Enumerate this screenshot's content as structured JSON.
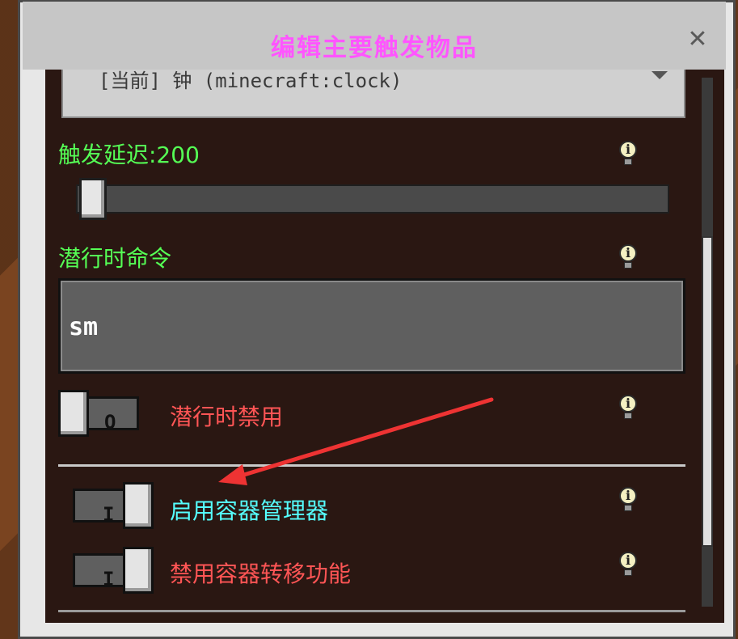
{
  "dialog": {
    "title": "编辑主要触发物品",
    "close_icon": "close-icon"
  },
  "dropdown": {
    "value": "[当前] 钟 (minecraft:clock)"
  },
  "trigger_delay": {
    "label": "触发延迟:200",
    "slider_value": 200
  },
  "sneak_command": {
    "label": "潜行时命令",
    "value": "sm"
  },
  "sneak_disable": {
    "label": "潜行时禁用",
    "state": "off",
    "glyph": "O"
  },
  "container_manager": {
    "label": "启用容器管理器",
    "state": "on",
    "glyph": "I"
  },
  "container_transfer": {
    "label": "禁用容器转移功能",
    "state": "on",
    "glyph": "I"
  },
  "colors": {
    "title": "#ff55ff",
    "green_label": "#55ff55",
    "red_label": "#ff5555",
    "cyan_label": "#55ffff",
    "annotation_arrow": "#ee3333"
  },
  "icons": [
    "close-icon",
    "info-bulb-icon",
    "dropdown-caret-icon"
  ]
}
